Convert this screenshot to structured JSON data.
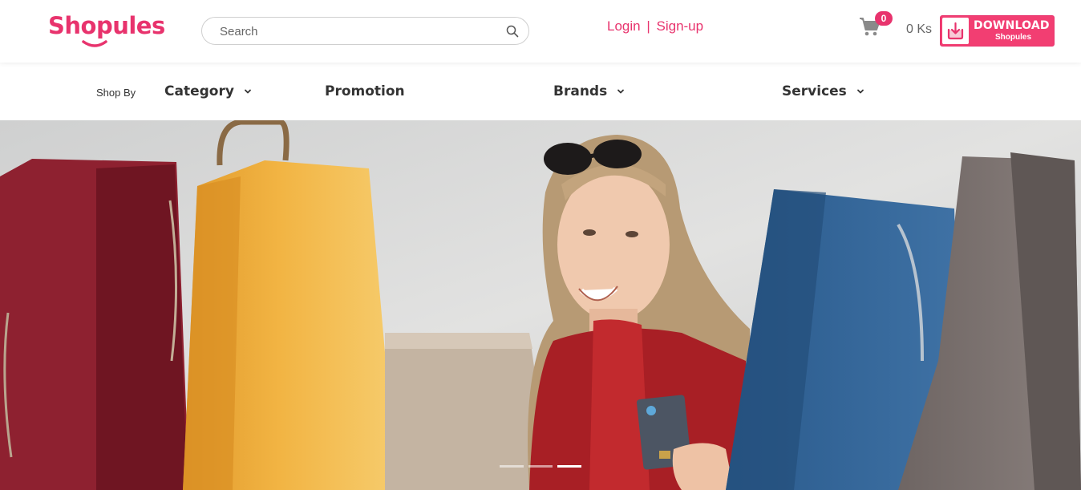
{
  "brand": {
    "name": "Shopules",
    "color": "#e8336d"
  },
  "search": {
    "placeholder": "Search",
    "icon": "search-icon"
  },
  "auth": {
    "login": "Login",
    "separator": "|",
    "signup": "Sign-up"
  },
  "cart": {
    "icon": "cart-icon",
    "count": "0",
    "total": "0 Ks"
  },
  "download": {
    "title": "DOWNLOAD",
    "subtitle": "Shopules",
    "icon": "download-tray-icon"
  },
  "nav": {
    "shop_by": "Shop By",
    "items": [
      {
        "label": "Category",
        "has_dropdown": true
      },
      {
        "label": "Promotion",
        "has_dropdown": false
      },
      {
        "label": "Brands",
        "has_dropdown": true
      },
      {
        "label": "Services",
        "has_dropdown": true
      }
    ]
  },
  "hero": {
    "slides": 3,
    "active_slide": 3
  }
}
